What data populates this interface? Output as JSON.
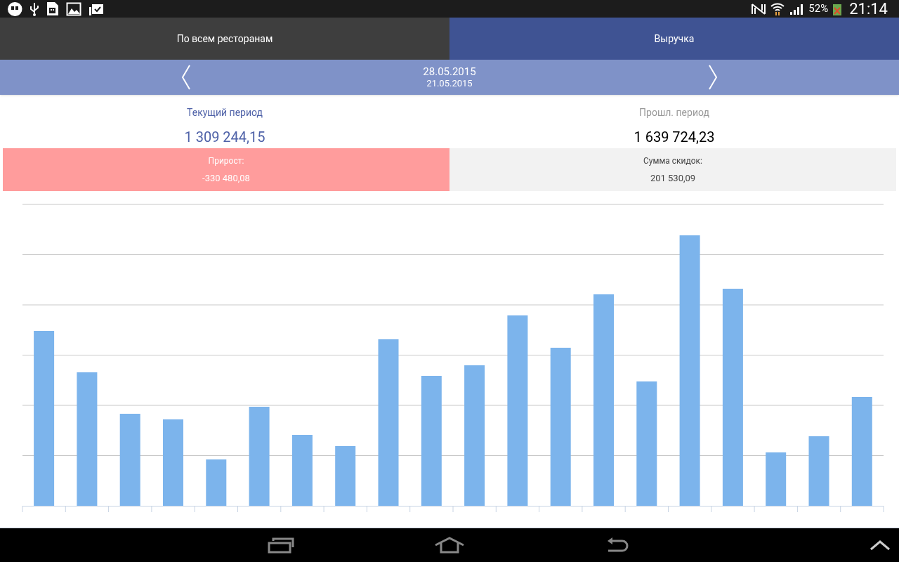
{
  "status_bar": {
    "battery": "52%",
    "time": "21:14"
  },
  "tabs": [
    {
      "label": "По всем ресторанам",
      "selected": false
    },
    {
      "label": "Выручка",
      "selected": true
    }
  ],
  "date_bar": {
    "end_date": "28.05.2015",
    "start_date": "21.05.2015"
  },
  "periods": [
    {
      "label": "Текущий период",
      "value": "1 309 244,15",
      "selected": true
    },
    {
      "label": "Прошл. период",
      "value": "1 639 724,23",
      "selected": false
    }
  ],
  "stats": [
    {
      "label": "Прирост:",
      "value": "-330 480,08",
      "negative": true
    },
    {
      "label": "Сумма скидок:",
      "value": "201 530,09",
      "negative": false
    }
  ]
}
